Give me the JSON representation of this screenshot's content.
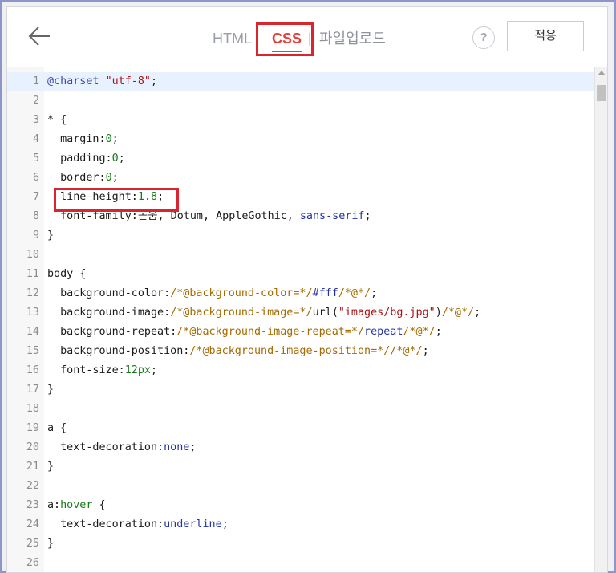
{
  "toolbar": {
    "tabs": [
      {
        "label": "HTML"
      },
      {
        "label": "CSS"
      },
      {
        "label": "파일업로드"
      }
    ],
    "help_label": "?",
    "apply_label": "적용"
  },
  "editor": {
    "lines": [
      {
        "n": "1",
        "tokens": [
          {
            "t": "@charset ",
            "c": "kw"
          },
          {
            "t": "\"utf-8\"",
            "c": "str"
          },
          {
            "t": ";",
            "c": "sel"
          }
        ]
      },
      {
        "n": "2",
        "tokens": []
      },
      {
        "n": "3",
        "tokens": [
          {
            "t": "* {",
            "c": "sel"
          }
        ]
      },
      {
        "n": "4",
        "tokens": [
          {
            "t": "  margin:",
            "c": "sel"
          },
          {
            "t": "0",
            "c": "num"
          },
          {
            "t": ";",
            "c": "sel"
          }
        ]
      },
      {
        "n": "5",
        "tokens": [
          {
            "t": "  padding:",
            "c": "sel"
          },
          {
            "t": "0",
            "c": "num"
          },
          {
            "t": ";",
            "c": "sel"
          }
        ]
      },
      {
        "n": "6",
        "tokens": [
          {
            "t": "  border:",
            "c": "sel"
          },
          {
            "t": "0",
            "c": "num"
          },
          {
            "t": ";",
            "c": "sel"
          }
        ]
      },
      {
        "n": "7",
        "tokens": [
          {
            "t": "  line-height:",
            "c": "sel"
          },
          {
            "t": "1.8",
            "c": "num"
          },
          {
            "t": ";",
            "c": "sel"
          }
        ]
      },
      {
        "n": "8",
        "tokens": [
          {
            "t": "  font-family:",
            "c": "sel"
          },
          {
            "t": "돋움, Dotum, AppleGothic, ",
            "c": "sel"
          },
          {
            "t": "sans-serif",
            "c": "val"
          },
          {
            "t": ";",
            "c": "sel"
          }
        ]
      },
      {
        "n": "9",
        "tokens": [
          {
            "t": "}",
            "c": "sel"
          }
        ]
      },
      {
        "n": "10",
        "tokens": []
      },
      {
        "n": "11",
        "tokens": [
          {
            "t": "body {",
            "c": "sel"
          }
        ]
      },
      {
        "n": "12",
        "tokens": [
          {
            "t": "  background-color:",
            "c": "sel"
          },
          {
            "t": "/*@background-color=*/",
            "c": "com"
          },
          {
            "t": "#fff",
            "c": "val"
          },
          {
            "t": "/*@*/",
            "c": "com"
          },
          {
            "t": ";",
            "c": "sel"
          }
        ]
      },
      {
        "n": "13",
        "tokens": [
          {
            "t": "  background-image:",
            "c": "sel"
          },
          {
            "t": "/*@background-image=*/",
            "c": "com"
          },
          {
            "t": "url(",
            "c": "sel"
          },
          {
            "t": "\"images/bg.jpg\"",
            "c": "str"
          },
          {
            "t": ")",
            "c": "sel"
          },
          {
            "t": "/*@*/",
            "c": "com"
          },
          {
            "t": ";",
            "c": "sel"
          }
        ]
      },
      {
        "n": "14",
        "tokens": [
          {
            "t": "  background-repeat:",
            "c": "sel"
          },
          {
            "t": "/*@background-image-repeat=*/",
            "c": "com"
          },
          {
            "t": "repeat",
            "c": "val"
          },
          {
            "t": "/*@*/",
            "c": "com"
          },
          {
            "t": ";",
            "c": "sel"
          }
        ]
      },
      {
        "n": "15",
        "tokens": [
          {
            "t": "  background-position:",
            "c": "sel"
          },
          {
            "t": "/*@background-image-position=*//*@*/",
            "c": "com"
          },
          {
            "t": ";",
            "c": "sel"
          }
        ]
      },
      {
        "n": "16",
        "tokens": [
          {
            "t": "  font-size:",
            "c": "sel"
          },
          {
            "t": "12px",
            "c": "num"
          },
          {
            "t": ";",
            "c": "sel"
          }
        ]
      },
      {
        "n": "17",
        "tokens": [
          {
            "t": "}",
            "c": "sel"
          }
        ]
      },
      {
        "n": "18",
        "tokens": []
      },
      {
        "n": "19",
        "tokens": [
          {
            "t": "a {",
            "c": "sel"
          }
        ]
      },
      {
        "n": "20",
        "tokens": [
          {
            "t": "  text-decoration:",
            "c": "sel"
          },
          {
            "t": "none",
            "c": "val"
          },
          {
            "t": ";",
            "c": "sel"
          }
        ]
      },
      {
        "n": "21",
        "tokens": [
          {
            "t": "}",
            "c": "sel"
          }
        ]
      },
      {
        "n": "22",
        "tokens": []
      },
      {
        "n": "23",
        "tokens": [
          {
            "t": "a:",
            "c": "sel"
          },
          {
            "t": "hover",
            "c": "num"
          },
          {
            "t": " {",
            "c": "sel"
          }
        ]
      },
      {
        "n": "24",
        "tokens": [
          {
            "t": "  text-decoration:",
            "c": "sel"
          },
          {
            "t": "underline",
            "c": "val"
          },
          {
            "t": ";",
            "c": "sel"
          }
        ]
      },
      {
        "n": "25",
        "tokens": [
          {
            "t": "}",
            "c": "sel"
          }
        ]
      },
      {
        "n": "26",
        "tokens": []
      }
    ]
  }
}
